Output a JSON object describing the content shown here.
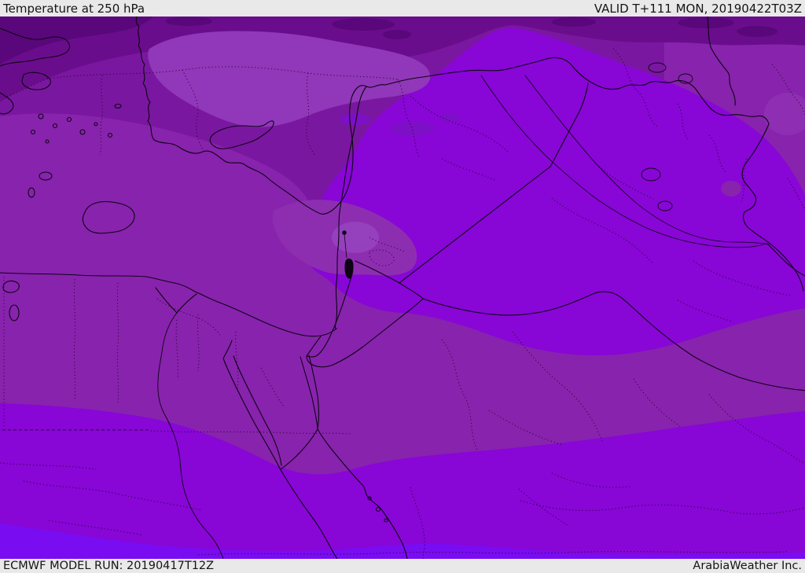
{
  "header": {
    "title": "Temperature at 250 hPa",
    "valid": "VALID T+111 MON, 20190422T03Z"
  },
  "footer": {
    "model_run": "ECMWF MODEL RUN: 20190417T12Z",
    "branding": "ArabiaWeather Inc."
  },
  "map": {
    "kind": "filled-contour temperature chart over Middle East / Eastern Mediterranean",
    "parameter": "Temperature",
    "level": "250 hPa",
    "palette": {
      "base_dull": "#7a17a0",
      "band_dull_bright": "#8823ad",
      "dark_strip": "#6a0d8c",
      "darkest": "#59077a",
      "bright": "#8806d6",
      "violet_bottom": "#7a0cf2",
      "light_patch": "#9137b9",
      "light_ne": "#8e2fb3",
      "lavender": "#8d2eb1",
      "lavender_core": "#9745c0",
      "syria_blob": "#7d0fc6",
      "coast": "#0d0414",
      "admin": "#1c0420",
      "bar_bg": "#e9e9e9",
      "bar_text": "#151515"
    }
  }
}
